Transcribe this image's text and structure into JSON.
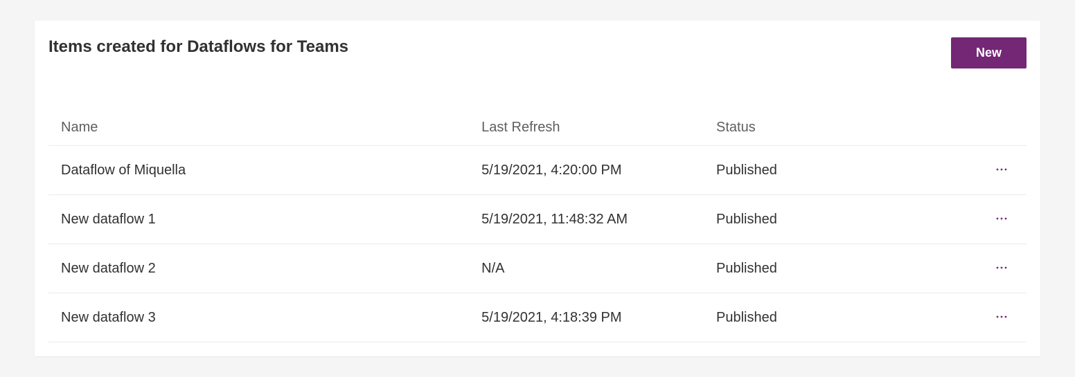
{
  "header": {
    "title": "Items created for Dataflows for Teams",
    "new_button_label": "New"
  },
  "table": {
    "columns": {
      "name": "Name",
      "last_refresh": "Last Refresh",
      "status": "Status"
    },
    "rows": [
      {
        "name": "Dataflow of Miquella",
        "last_refresh": "5/19/2021, 4:20:00 PM",
        "status": "Published"
      },
      {
        "name": "New dataflow 1",
        "last_refresh": "5/19/2021, 11:48:32 AM",
        "status": "Published"
      },
      {
        "name": "New dataflow 2",
        "last_refresh": "N/A",
        "status": "Published"
      },
      {
        "name": "New dataflow 3",
        "last_refresh": "5/19/2021, 4:18:39 PM",
        "status": "Published"
      }
    ]
  },
  "colors": {
    "accent": "#742774",
    "text_primary": "#323130",
    "text_secondary": "#605e5c",
    "border": "#edebe9",
    "page_background": "#f5f5f5",
    "card_background": "#ffffff"
  }
}
